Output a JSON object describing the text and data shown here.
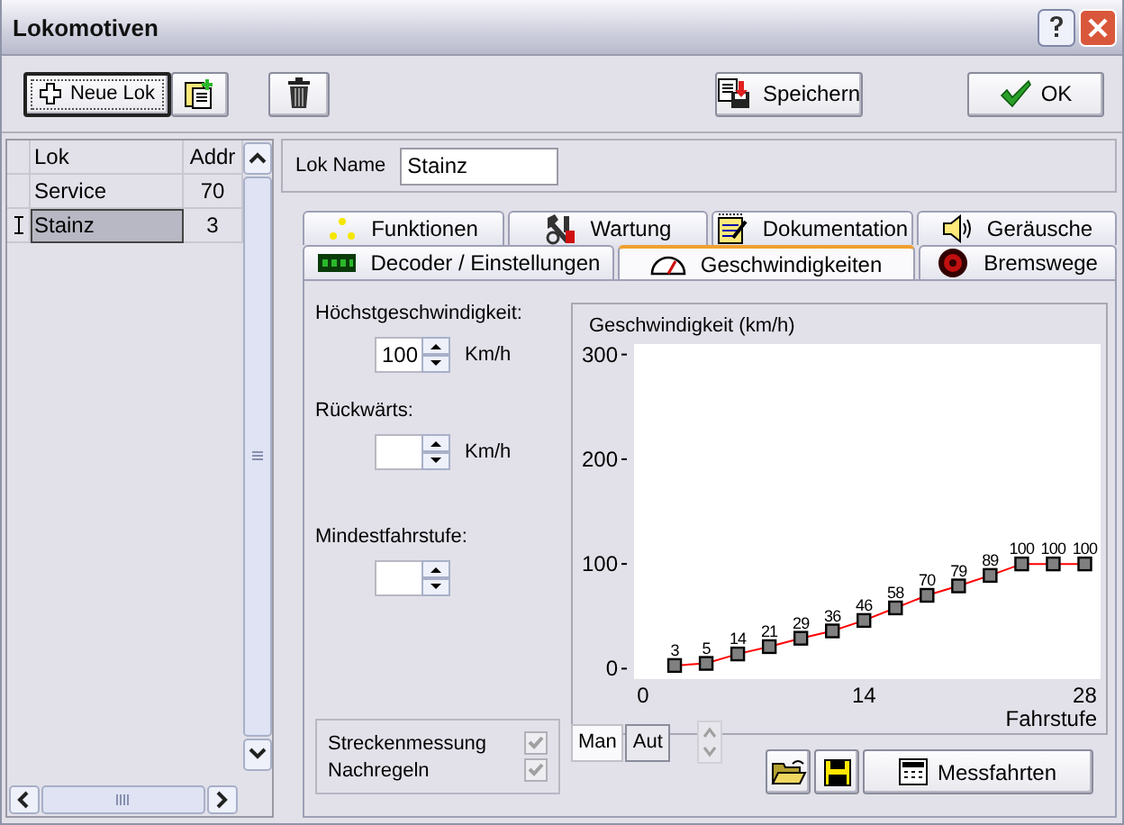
{
  "window": {
    "title": "Lokomotiven"
  },
  "toolbar": [
    {
      "kind": "new",
      "label": "Neue Lok"
    },
    {
      "kind": "copy"
    },
    {
      "kind": "delete"
    },
    {
      "kind": "save",
      "label": "Speichern"
    },
    {
      "kind": "ok",
      "label": "OK"
    }
  ],
  "loco_table": {
    "columns": [
      "Lok",
      "Addr"
    ],
    "rows": [
      {
        "cells": [
          "Service",
          "70"
        ],
        "selected": false
      },
      {
        "cells": [
          "Stainz",
          "3"
        ],
        "selected": true
      }
    ]
  },
  "lok_name": {
    "label": "Lok Name",
    "value": "Stainz"
  },
  "tab_rows": [
    {
      "tabs": [
        {
          "label": "Funktionen",
          "selected": false
        },
        {
          "label": "Wartung",
          "selected": false
        },
        {
          "label": "Dokumentation",
          "selected": false
        },
        {
          "label": "Geräusche",
          "selected": false
        }
      ]
    },
    {
      "tabs": [
        {
          "label": "Decoder / Einstellungen",
          "selected": false
        },
        {
          "label": "Geschwindigkeiten",
          "selected": true
        },
        {
          "label": "Bremswege",
          "selected": false
        }
      ]
    }
  ],
  "speed_fields": [
    {
      "label": "Höchstgeschwindigkeit:",
      "value": "100",
      "unit": "Km/h"
    },
    {
      "label": "Rückwärts:",
      "unit": "Km/h"
    },
    {
      "label": "Mindestfahrstufe:"
    }
  ],
  "options": [
    {
      "label": "Streckenmessung",
      "checked": true,
      "disabled": true
    },
    {
      "label": "Nachregeln",
      "checked": true,
      "disabled": true
    }
  ],
  "chart": {
    "chart_data": {
      "type": "line",
      "title": "Geschwindigkeit (km/h)",
      "xlabel": "Fahrstufe",
      "x": [
        2,
        4,
        6,
        8,
        10,
        12,
        14,
        16,
        18,
        20,
        22,
        24,
        26,
        28
      ],
      "series": [
        {
          "color": "#ff0000",
          "marker": "square",
          "values": [
            3,
            5,
            14,
            21,
            29,
            36,
            46,
            58,
            70,
            79,
            89,
            100,
            100,
            100
          ]
        }
      ],
      "xlim": [
        0,
        29
      ],
      "ylim": [
        -10,
        310
      ],
      "xticks": [
        0,
        14,
        28
      ],
      "yticks": [
        0,
        100,
        200,
        300
      ],
      "data_labels": true
    }
  },
  "mode_toggle": [
    {
      "label": "Man",
      "selected": true
    },
    {
      "label": "Aut",
      "selected": false
    }
  ],
  "stepper": {
    "disabled": true
  },
  "bottom_buttons": [
    {
      "kind": "open"
    },
    {
      "kind": "save"
    },
    {
      "kind": "measure",
      "label": "Messfahrten"
    }
  ]
}
